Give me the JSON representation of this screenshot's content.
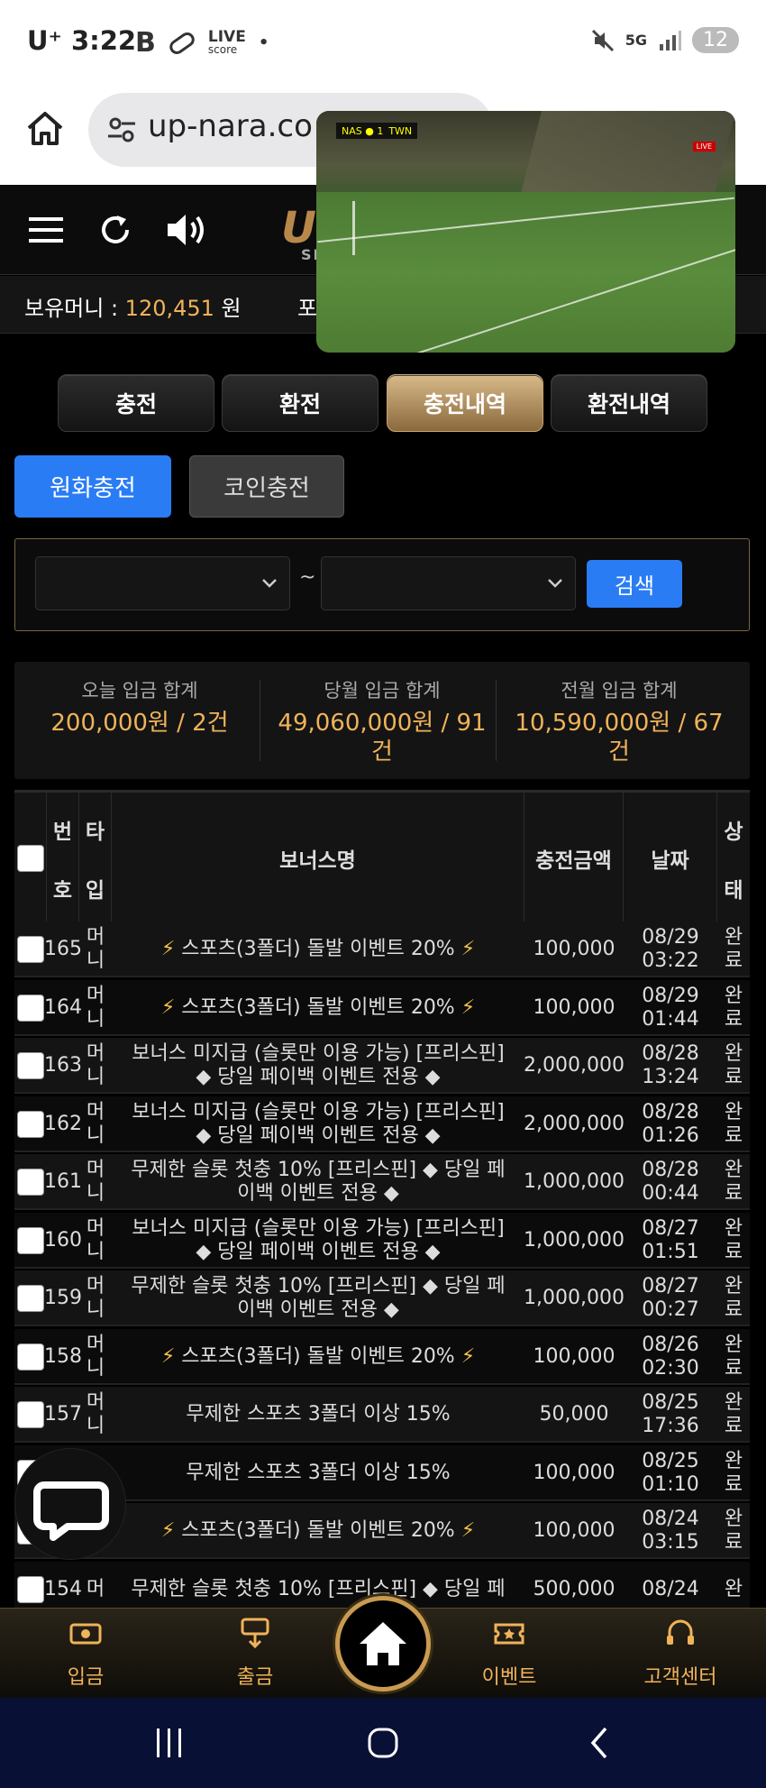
{
  "status_bar": {
    "carrier": "U⁺",
    "time": "3:22",
    "app_icons": [
      "b-icon",
      "pill-icon",
      "live-score-icon",
      "dot-icon"
    ],
    "right_icons": [
      "mute-icon",
      "5g-icon",
      "signal-icon"
    ],
    "live_label": "LIVE",
    "score_label": "score",
    "network": "5G",
    "battery": "12"
  },
  "browser": {
    "url": "up-nara.co"
  },
  "header": {
    "logo_text": "U",
    "logo_sub": "SP"
  },
  "money": {
    "label": "보유머니 : ",
    "value": "120,451",
    "unit": " 원",
    "point_label": "포"
  },
  "pip": {
    "score_text": "NAS ● 1",
    "team2": "TWN",
    "live": "LIVE"
  },
  "tabs": [
    {
      "label": "충전",
      "active": false
    },
    {
      "label": "환전",
      "active": false
    },
    {
      "label": "충전내역",
      "active": true
    },
    {
      "label": "환전내역",
      "active": false
    }
  ],
  "subtabs": [
    {
      "label": "원화충전",
      "active": true
    },
    {
      "label": "코인충전",
      "active": false
    }
  ],
  "search": {
    "start_value": "",
    "end_value": "",
    "separator": "~",
    "button_label": "검색"
  },
  "summary": [
    {
      "title": "오늘 입금 합계",
      "value_line1": "200,000원 / 2건",
      "value_line2": ""
    },
    {
      "title": "당월 입금 합계",
      "value_line1": "49,060,000원 / 91",
      "value_line2": "건"
    },
    {
      "title": "전월 입금 합계",
      "value_line1": "10,590,000원 / 67",
      "value_line2": "건"
    }
  ],
  "table": {
    "headers": {
      "num_top": "번",
      "num_bottom": "호",
      "type_top": "타",
      "type_bottom": "입",
      "bonus": "보너스명",
      "amount": "충전금액",
      "date": "날짜",
      "status_top": "상",
      "status_bottom": "태"
    },
    "rows": [
      {
        "num": "165",
        "type1": "머",
        "type2": "니",
        "bonus1": "⚡ 스포츠(3폴더) 돌발 이벤트 20% ⚡",
        "bonus2": "",
        "amount": "100,000",
        "date1": "08/29",
        "date2": "03:22",
        "status1": "완",
        "status2": "료"
      },
      {
        "num": "164",
        "type1": "머",
        "type2": "니",
        "bonus1": "⚡ 스포츠(3폴더) 돌발 이벤트 20% ⚡",
        "bonus2": "",
        "amount": "100,000",
        "date1": "08/29",
        "date2": "01:44",
        "status1": "완",
        "status2": "료"
      },
      {
        "num": "163",
        "type1": "머",
        "type2": "니",
        "bonus1": "보너스 미지급 (슬롯만 이용 가능) [프리스핀]",
        "bonus2": "◆ 당일 페이백 이벤트 전용 ◆",
        "amount": "2,000,000",
        "date1": "08/28",
        "date2": "13:24",
        "status1": "완",
        "status2": "료"
      },
      {
        "num": "162",
        "type1": "머",
        "type2": "니",
        "bonus1": "보너스 미지급 (슬롯만 이용 가능) [프리스핀]",
        "bonus2": "◆ 당일 페이백 이벤트 전용 ◆",
        "amount": "2,000,000",
        "date1": "08/28",
        "date2": "01:26",
        "status1": "완",
        "status2": "료"
      },
      {
        "num": "161",
        "type1": "머",
        "type2": "니",
        "bonus1": "무제한 슬롯 첫충 10% [프리스핀] ◆ 당일 페",
        "bonus2": "이백 이벤트 전용 ◆",
        "amount": "1,000,000",
        "date1": "08/28",
        "date2": "00:44",
        "status1": "완",
        "status2": "료"
      },
      {
        "num": "160",
        "type1": "머",
        "type2": "니",
        "bonus1": "보너스 미지급 (슬롯만 이용 가능) [프리스핀]",
        "bonus2": "◆ 당일 페이백 이벤트 전용 ◆",
        "amount": "1,000,000",
        "date1": "08/27",
        "date2": "01:51",
        "status1": "완",
        "status2": "료"
      },
      {
        "num": "159",
        "type1": "머",
        "type2": "니",
        "bonus1": "무제한 슬롯 첫충 10% [프리스핀] ◆ 당일 페",
        "bonus2": "이백 이벤트 전용 ◆",
        "amount": "1,000,000",
        "date1": "08/27",
        "date2": "00:27",
        "status1": "완",
        "status2": "료"
      },
      {
        "num": "158",
        "type1": "머",
        "type2": "니",
        "bonus1": "⚡ 스포츠(3폴더) 돌발 이벤트 20% ⚡",
        "bonus2": "",
        "amount": "100,000",
        "date1": "08/26",
        "date2": "02:30",
        "status1": "완",
        "status2": "료"
      },
      {
        "num": "157",
        "type1": "머",
        "type2": "니",
        "bonus1": "무제한 스포츠 3폴더 이상 15%",
        "bonus2": "",
        "amount": "50,000",
        "date1": "08/25",
        "date2": "17:36",
        "status1": "완",
        "status2": "료"
      },
      {
        "num": "",
        "type1": "",
        "type2": "",
        "bonus1": "무제한 스포츠 3폴더 이상 15%",
        "bonus2": "",
        "amount": "100,000",
        "date1": "08/25",
        "date2": "01:10",
        "status1": "완",
        "status2": "료"
      },
      {
        "num": "",
        "type1": "",
        "type2": "니",
        "bonus1": "⚡ 스포츠(3폴더) 돌발 이벤트 20% ⚡",
        "bonus2": "",
        "amount": "100,000",
        "date1": "08/24",
        "date2": "03:15",
        "status1": "완",
        "status2": "료"
      },
      {
        "num": "154",
        "type1": "머",
        "type2": "",
        "bonus1": "무제한 슬롯 첫충 10% [프리스핀] ◆ 당일 페",
        "bonus2": "",
        "amount": "500,000",
        "date1": "08/24",
        "date2": "",
        "status1": "완",
        "status2": ""
      }
    ]
  },
  "bottom_nav": [
    {
      "label": "입금",
      "icon": "deposit-icon"
    },
    {
      "label": "출금",
      "icon": "withdraw-icon"
    },
    {
      "label": "",
      "icon": "home-icon"
    },
    {
      "label": "이벤트",
      "icon": "event-ticket-icon"
    },
    {
      "label": "고객센터",
      "icon": "support-headset-icon"
    }
  ],
  "android_nav": [
    "recent-apps-icon",
    "home-circle-icon",
    "back-icon"
  ],
  "colors": {
    "gold": "#f0b35a",
    "blue": "#2a7cf5",
    "background": "#000000"
  }
}
